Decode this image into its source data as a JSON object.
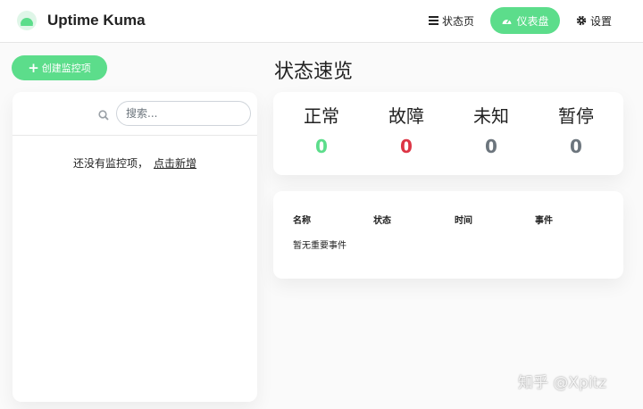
{
  "header": {
    "brand": "Uptime Kuma",
    "nav": {
      "status_page": "状态页",
      "dashboard": "仪表盘",
      "settings": "设置"
    }
  },
  "sidebar": {
    "add_button": "创建监控项",
    "search_placeholder": "搜索...",
    "empty_text": "还没有监控项，",
    "empty_link": "点击新增"
  },
  "main": {
    "title": "状态速览",
    "stats": [
      {
        "label": "正常",
        "value": "0",
        "color": "#5cdd8b"
      },
      {
        "label": "故障",
        "value": "0",
        "color": "#dc3545"
      },
      {
        "label": "未知",
        "value": "0",
        "color": "#6c757d"
      },
      {
        "label": "暂停",
        "value": "0",
        "color": "#6c757d"
      }
    ],
    "events": {
      "columns": [
        "名称",
        "状态",
        "时间",
        "事件"
      ],
      "empty": "暂无重要事件"
    }
  },
  "watermark": "知乎 @Xpitz",
  "colors": {
    "accent": "#5cdd8b",
    "down": "#dc3545",
    "muted": "#6c757d"
  }
}
